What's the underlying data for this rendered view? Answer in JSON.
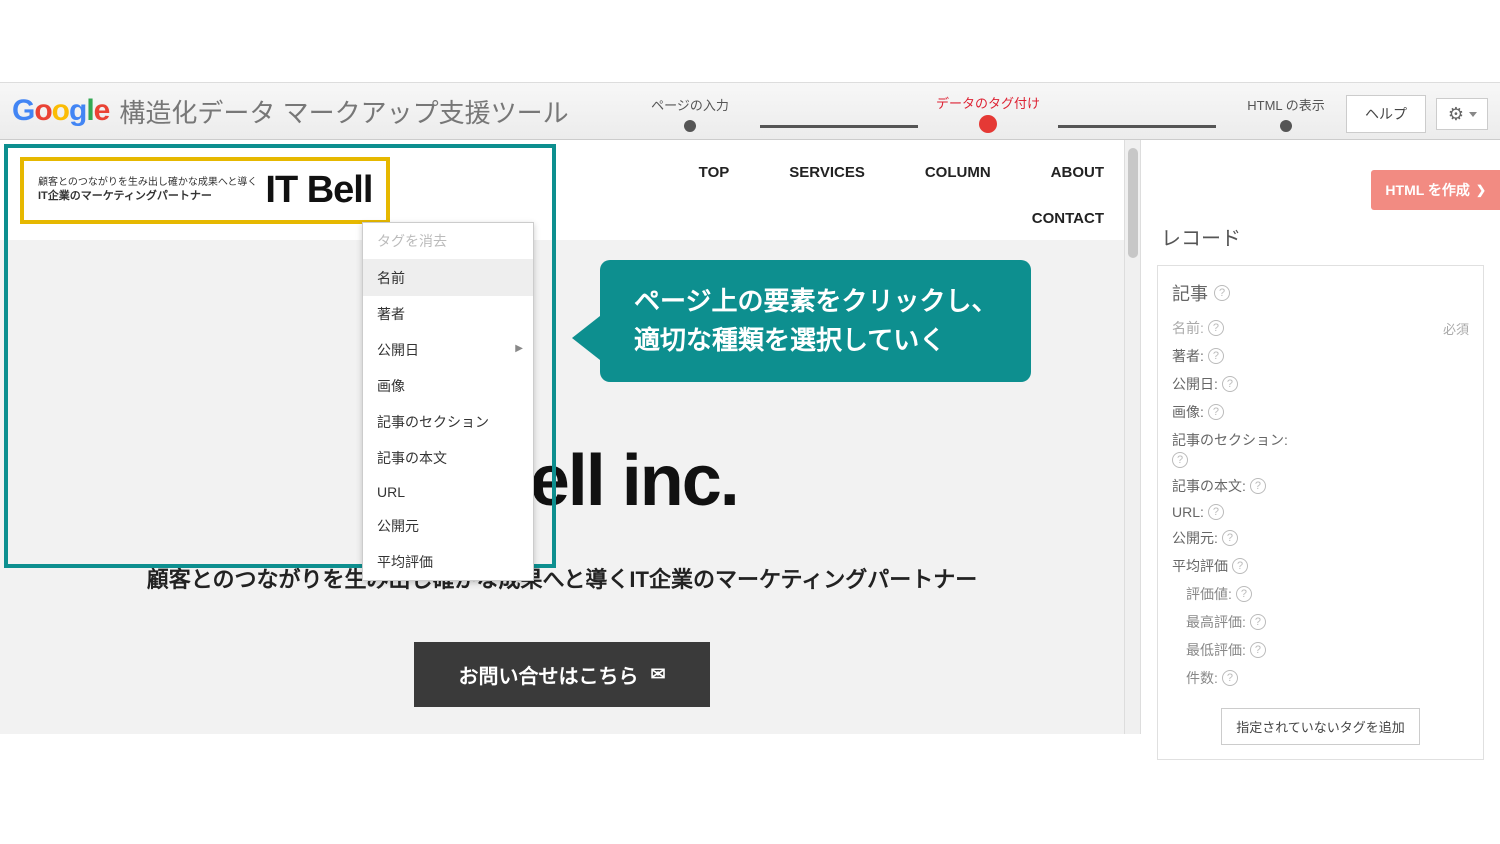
{
  "topbar": {
    "tool_title": "構造化データ マークアップ支援ツール",
    "steps": [
      "ページの入力",
      "データのタグ付け",
      "HTML の表示"
    ],
    "help": "ヘルプ"
  },
  "preview": {
    "logo_small_line1": "顧客とのつながりを生み出し確かな成果へと導く",
    "logo_small_line2": "IT企業のマーケティングパートナー",
    "logo_big": "IT Bell",
    "nav": [
      "TOP",
      "SERVICES",
      "COLUMN",
      "ABOUT"
    ],
    "nav2": "CONTACT",
    "hero_logo_pre": "  ",
    "hero_logo": "ell inc.",
    "hero_sub": "顧客とのつながりを生み出し確かな成果へと導くIT企業のマーケティングパートナー",
    "cta": "お問い合せはこちら"
  },
  "context_menu": {
    "clear": "タグを消去",
    "items": [
      "名前",
      "著者",
      "公開日",
      "画像",
      "記事のセクション",
      "記事の本文",
      "URL",
      "公開元",
      "平均評価"
    ]
  },
  "callout": {
    "line1": "ページ上の要素をクリックし、",
    "line2": "適切な種類を選択していく"
  },
  "sidebar": {
    "create_html": "HTML を作成",
    "title": "レコード",
    "record_head": "記事",
    "required": "必須",
    "fields": {
      "name": "名前:",
      "author": "著者:",
      "pubdate": "公開日:",
      "image": "画像:",
      "section": "記事のセクション:",
      "body": "記事の本文:",
      "url": "URL:",
      "publisher": "公開元:",
      "rating": "平均評価",
      "rating_value": "評価値:",
      "rating_best": "最高評価:",
      "rating_worst": "最低評価:",
      "rating_count": "件数:"
    },
    "add_tag": "指定されていないタグを追加"
  }
}
